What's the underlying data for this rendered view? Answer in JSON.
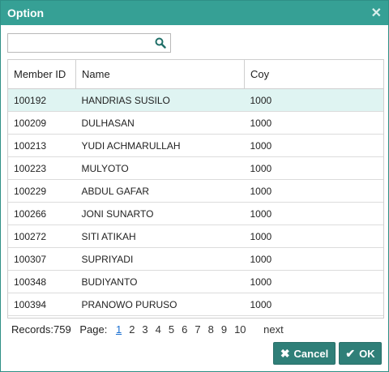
{
  "dialog": {
    "title": "Option",
    "close_glyph": "✕"
  },
  "search": {
    "value": "",
    "placeholder": ""
  },
  "table": {
    "headers": [
      "Member ID",
      "Name",
      "Coy"
    ],
    "rows": [
      {
        "id": "100192",
        "name": "HANDRIAS SUSILO",
        "coy": "1000",
        "selected": true
      },
      {
        "id": "100209",
        "name": "DULHASAN",
        "coy": "1000"
      },
      {
        "id": "100213",
        "name": "YUDI ACHMARULLAH",
        "coy": "1000"
      },
      {
        "id": "100223",
        "name": "MULYOTO",
        "coy": "1000"
      },
      {
        "id": "100229",
        "name": "ABDUL GAFAR",
        "coy": "1000"
      },
      {
        "id": "100266",
        "name": "JONI SUNARTO",
        "coy": "1000"
      },
      {
        "id": "100272",
        "name": "SITI ATIKAH",
        "coy": "1000"
      },
      {
        "id": "100307",
        "name": "SUPRIYADI",
        "coy": "1000"
      },
      {
        "id": "100348",
        "name": "BUDIYANTO",
        "coy": "1000"
      },
      {
        "id": "100394",
        "name": "PRANOWO PURUSO",
        "coy": "1000"
      }
    ]
  },
  "pager": {
    "records_label": "Records:759",
    "page_label": "Page:",
    "pages": [
      "1",
      "2",
      "3",
      "4",
      "5",
      "6",
      "7",
      "8",
      "9",
      "10"
    ],
    "current_page": "1",
    "next_label": "next"
  },
  "buttons": {
    "cancel_label": "Cancel",
    "ok_label": "OK"
  },
  "colors": {
    "title_bar": "#36a095",
    "button": "#2f7f78",
    "selected_row": "#dff4f2",
    "link": "#1a6fd1"
  },
  "icons": {
    "search": "search-icon",
    "close": "close-icon",
    "cancel": "x-icon",
    "ok": "check-icon"
  }
}
